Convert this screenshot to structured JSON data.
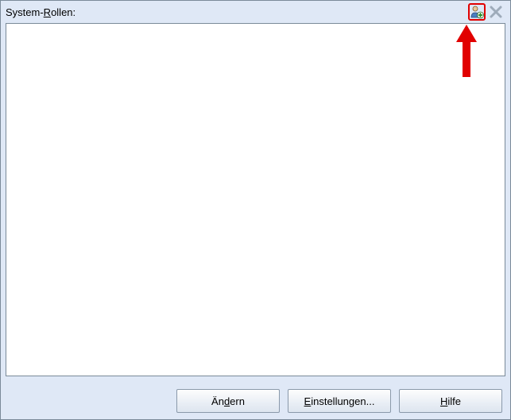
{
  "header": {
    "label_pre": "System-",
    "label_mnemonic": "R",
    "label_post": "ollen:"
  },
  "icons": {
    "add_role": "add-role-icon",
    "remove_role": "remove-role-icon"
  },
  "list": {
    "items": []
  },
  "buttons": {
    "change_pre": "Än",
    "change_mnemonic": "d",
    "change_post": "ern",
    "settings_pre": "",
    "settings_mnemonic": "E",
    "settings_post": "instellungen...",
    "help_pre": "",
    "help_mnemonic": "H",
    "help_post": "ilfe"
  },
  "annotation": {
    "highlight_target": "add-role-button"
  }
}
